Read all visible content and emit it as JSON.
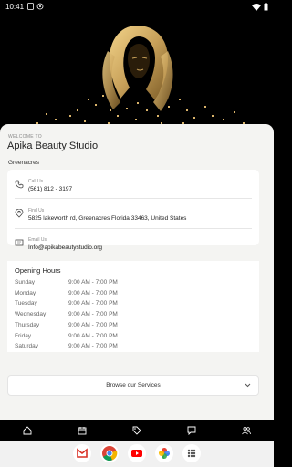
{
  "status_bar": {
    "time": "10:41"
  },
  "welcome": {
    "label": "WELCOME TO",
    "studio_name": "Apika Beauty Studio",
    "location": "Greenacres"
  },
  "contact": [
    {
      "label": "Call Us",
      "value": "(561) 812 - 3197",
      "icon": "phone-icon"
    },
    {
      "label": "Find Us",
      "value": "5825 lakeworth rd, Greenacres Florida 33463, United States",
      "icon": "map-pin-icon"
    },
    {
      "label": "Email Us",
      "value": "Info@apikabeautystudio.org",
      "icon": "email-icon"
    }
  ],
  "hours": {
    "title": "Opening Hours",
    "days": [
      {
        "day": "Sunday",
        "time": "9:00 AM - 7:00 PM"
      },
      {
        "day": "Monday",
        "time": "9:00 AM - 7:00 PM"
      },
      {
        "day": "Tuesday",
        "time": "9:00 AM - 7:00 PM"
      },
      {
        "day": "Wednesday",
        "time": "9:00 AM - 7:00 PM"
      },
      {
        "day": "Thursday",
        "time": "9:00 AM - 7:00 PM"
      },
      {
        "day": "Friday",
        "time": "9:00 AM - 7:00 PM"
      },
      {
        "day": "Saturday",
        "time": "9:00 AM - 7:00 PM"
      }
    ]
  },
  "browse": {
    "label": "Browse our Services"
  },
  "tabs": [
    {
      "icon": "home-icon",
      "active": true
    },
    {
      "icon": "calendar-icon",
      "active": false
    },
    {
      "icon": "tag-icon",
      "active": false
    },
    {
      "icon": "chat-icon",
      "active": false
    },
    {
      "icon": "people-icon",
      "active": false
    }
  ],
  "dock_apps": [
    {
      "icon": "gmail-icon"
    },
    {
      "icon": "chrome-icon"
    },
    {
      "icon": "youtube-icon"
    },
    {
      "icon": "photos-icon"
    },
    {
      "icon": "app-drawer-icon"
    }
  ],
  "colors": {
    "accent_gold": "#c8a15a",
    "background": "#000000",
    "card": "#f4f4f2"
  }
}
